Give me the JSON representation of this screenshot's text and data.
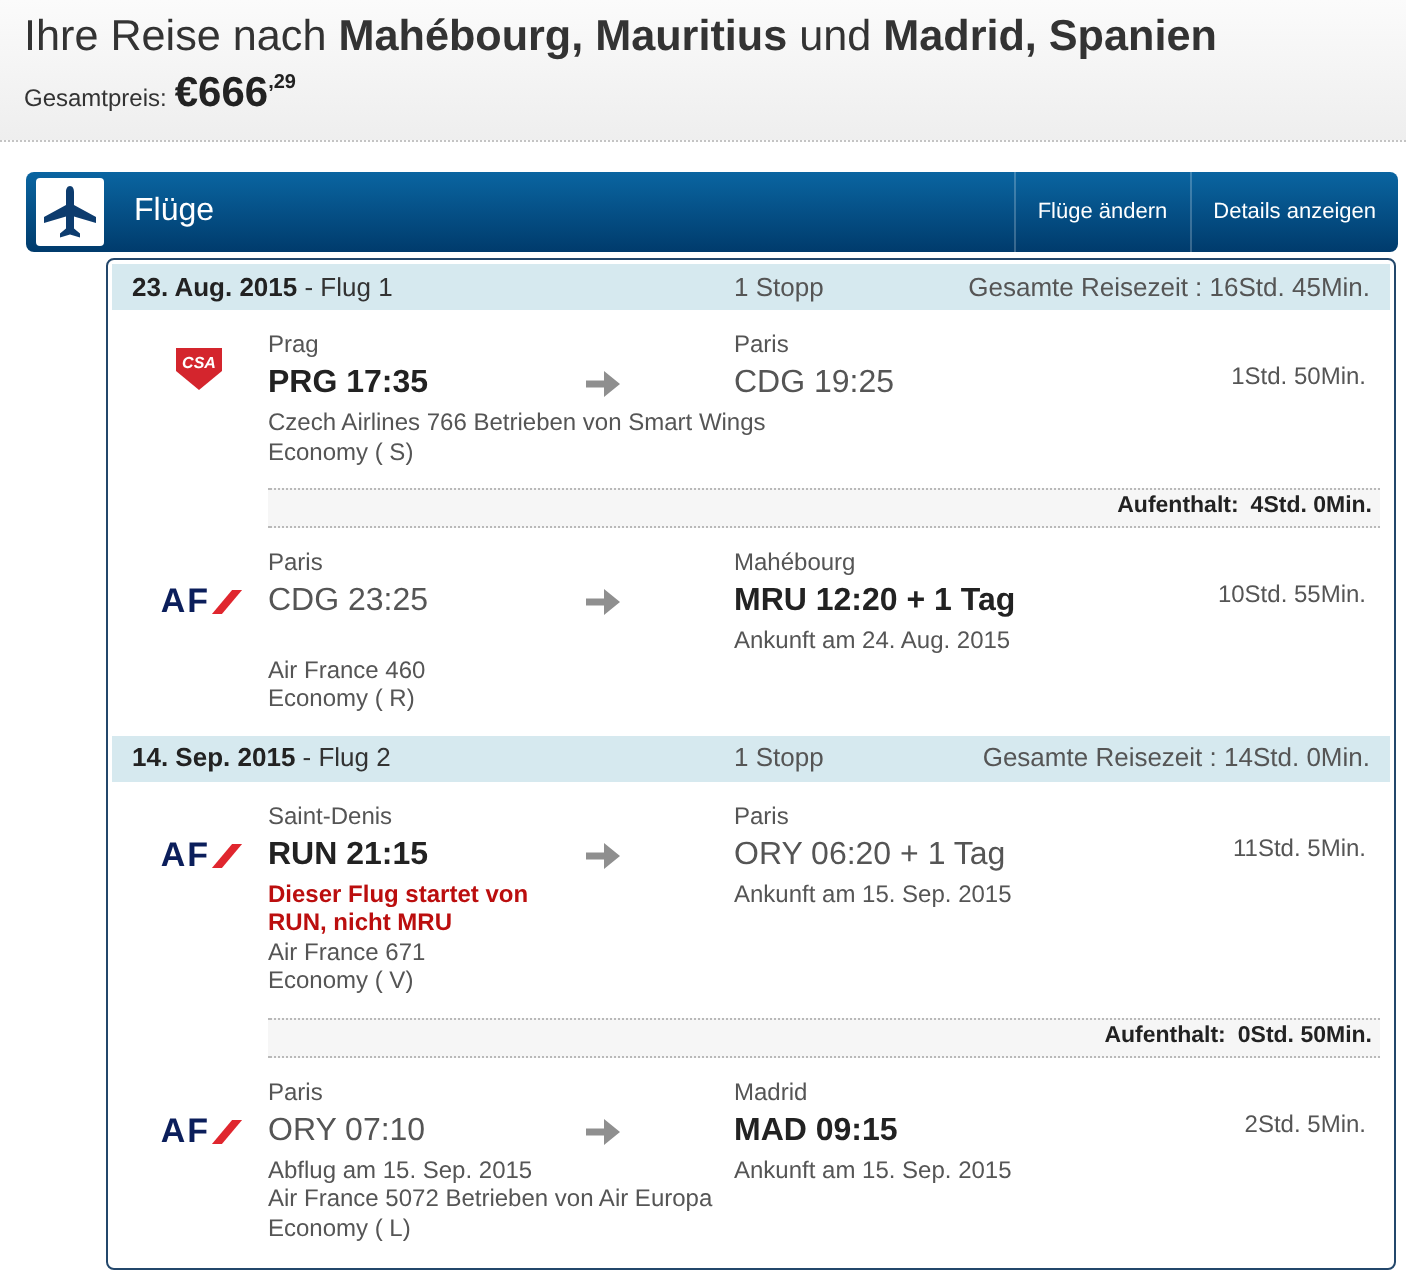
{
  "header": {
    "title": "Ihre Reise nach **Mahébourg, Mauritius** und **Madrid, Spanien**",
    "price_label": "Gesamtpreis:",
    "price": "€666$^{,29}$"
  },
  "section": {
    "title": "Flüge",
    "buttons": [
      "Flüge ändern",
      "Details anzeigen"
    ]
  },
  "flights": [
    {
      "title": "**23. Aug. 2015** - Flug 1",
      "stops": "1 Stopp",
      "total_time": "Gesamte Reisezeit : 16Std. 45Min.",
      "legs": [
        {
          "kind": "segment",
          "logo": {
            "kind": "shield",
            "text": "CSA"
          },
          "from": {
            "city": "Prag",
            "time": "PRG 17:35",
            "highlighted": true
          },
          "to": {
            "city": "Paris",
            "time": "CDG 19:25",
            "highlighted": false
          },
          "airline": "Czech Airlines 766 Betrieben von Smart Wings",
          "cabin": "Economy ( S)",
          "duration": "1Std. 50Min."
        },
        {
          "kind": "layover",
          "label": "Aufenthalt:",
          "duration": "4Std. 0Min."
        },
        {
          "kind": "segment",
          "logo": {
            "kind": "slash",
            "text": "AF"
          },
          "from": {
            "city": "Paris",
            "time": "CDG 23:25",
            "highlighted": false
          },
          "to": {
            "city": "Mahébourg",
            "time": "MRU 12:20 + 1 Tag",
            "highlighted": true,
            "date": "Ankunft am 24. Aug. 2015"
          },
          "airline": "Air France 460",
          "cabin": "Economy ( R)",
          "duration": "10Std. 55Min."
        }
      ]
    },
    {
      "title": "**14. Sep. 2015** - Flug 2",
      "stops": "1 Stopp",
      "total_time": "Gesamte Reisezeit : 14Std. 0Min.",
      "legs": [
        {
          "kind": "segment",
          "logo": {
            "kind": "slash",
            "text": "AF"
          },
          "from": {
            "city": "Saint-Denis",
            "time": "RUN 21:15",
            "highlighted": true,
            "warning": "Dieser Flug startet von RUN, nicht MRU"
          },
          "to": {
            "city": "Paris",
            "time": "ORY 06:20 + 1 Tag",
            "highlighted": false,
            "date": "Ankunft am 15. Sep. 2015"
          },
          "airline": "Air France 671",
          "cabin": "Economy ( V)",
          "duration": "11Std. 5Min."
        },
        {
          "kind": "layover",
          "label": "Aufenthalt:",
          "duration": "0Std. 50Min."
        },
        {
          "kind": "segment",
          "logo": {
            "kind": "slash",
            "text": "AF"
          },
          "from": {
            "city": "Paris",
            "time": "ORY 07:10",
            "highlighted": false,
            "date": "Abflug am 15. Sep. 2015"
          },
          "to": {
            "city": "Madrid",
            "time": "MAD 09:15",
            "highlighted": true,
            "date": "Ankunft am 15. Sep. 2015"
          },
          "airline": "Air France 5072 Betrieben von Air Europa",
          "cabin": "Economy ( L)",
          "duration": "2Std. 5Min."
        }
      ]
    }
  ]
}
